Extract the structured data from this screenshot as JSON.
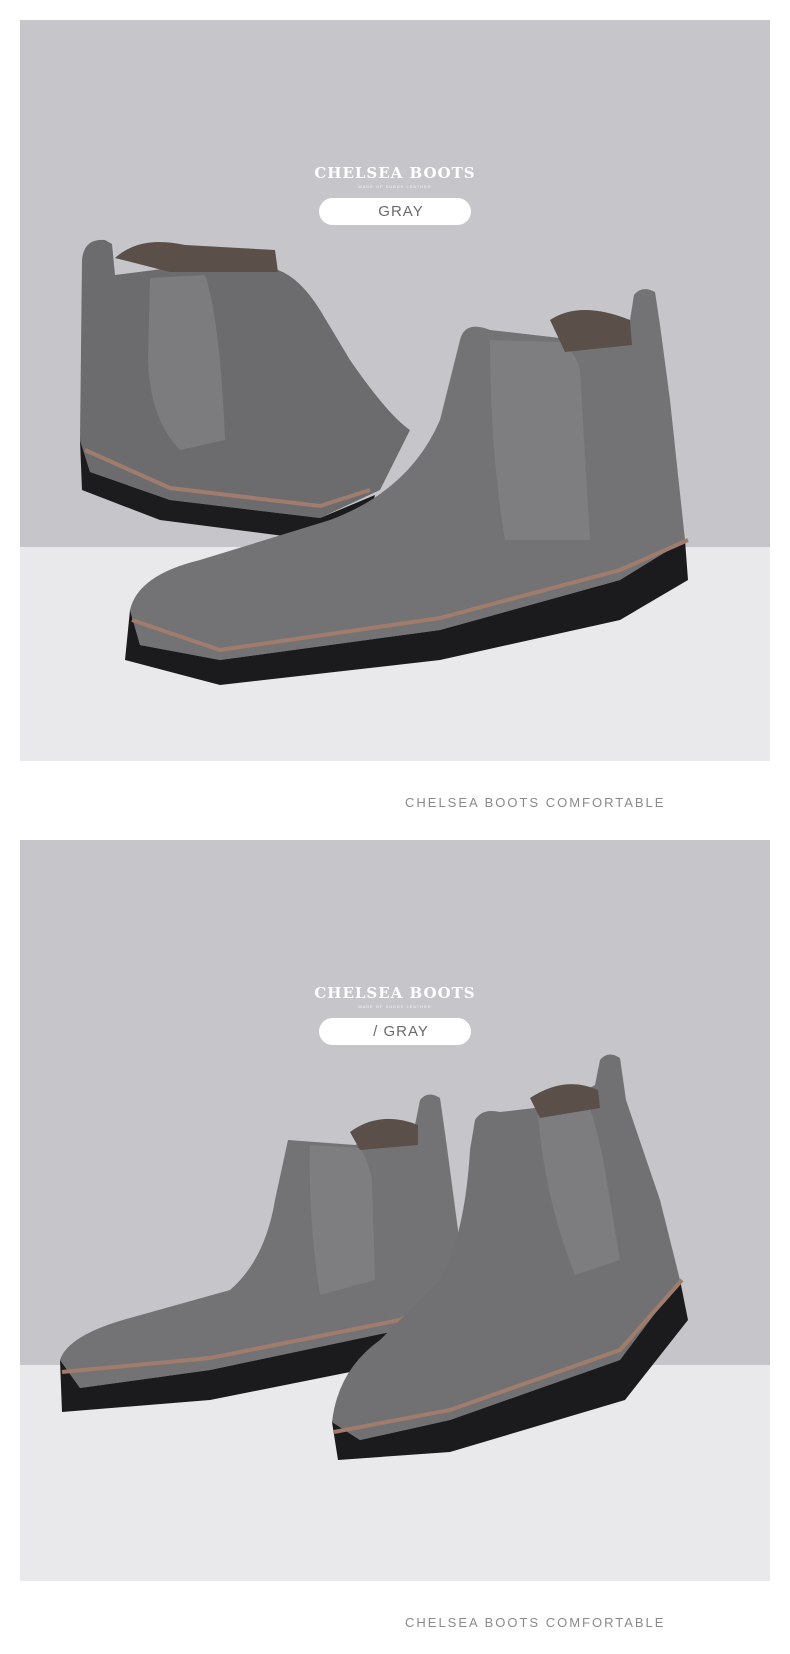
{
  "sections": [
    {
      "brand_title": "CHELSEA BOOTS",
      "brand_subtitle": "MADE OF SUEDE LEATHER",
      "color_label": "GRAY",
      "caption": "CHELSEA BOOTS COMFORTABLE"
    },
    {
      "brand_title": "CHELSEA BOOTS",
      "brand_subtitle": "MADE OF SUEDE LEATHER",
      "color_label": "/ GRAY",
      "caption": "CHELSEA BOOTS COMFORTABLE"
    }
  ],
  "colors": {
    "backdrop": "#c6c6ca",
    "floor": "#e9e9eb",
    "suede": "#6f6f72",
    "elastic": "#7d7d7f",
    "sole": "#1b1b1d",
    "welt": "#a07c6c"
  }
}
